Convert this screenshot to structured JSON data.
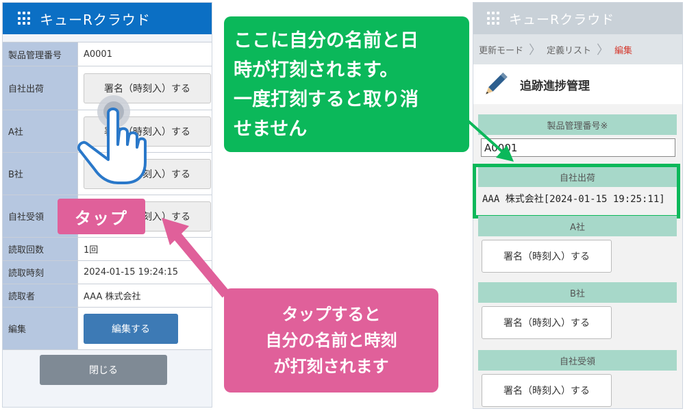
{
  "left_app": {
    "app_title": "キューRクラウド",
    "rows": [
      {
        "label": "製品管理番号",
        "value": "A0001"
      },
      {
        "label": "自社出荷",
        "button": "署名（時刻入）する"
      },
      {
        "label": "A社",
        "button": "署名（時刻入）する"
      },
      {
        "label": "B社",
        "button": "署名（時刻入）する"
      },
      {
        "label": "自社受領",
        "button": "署名（時刻入）する"
      },
      {
        "label": "読取回数",
        "value": "1回"
      },
      {
        "label": "読取時刻",
        "value": "2024-01-15 19:24:15"
      },
      {
        "label": "読取者",
        "value": "AAA 株式会社"
      },
      {
        "label": "編集",
        "button": "編集する"
      }
    ],
    "close_label": "閉じる"
  },
  "annotations": {
    "tap_label": "タップ",
    "pink_callout": [
      "タップすると",
      "自分の名前と時刻",
      "が打刻されます"
    ],
    "green_callout": [
      "ここに自分の名前と日",
      "時が打刻されます。",
      "一度打刻すると取り消",
      "せません"
    ]
  },
  "right_app": {
    "app_title": "キューRクラウド",
    "breadcrumb": [
      "更新モード",
      "定義リスト",
      "編集"
    ],
    "page_title": "追跡進捗管理",
    "product_no_label": "製品管理番号※",
    "product_no_value": "A0001",
    "sections": [
      {
        "label": "自社出荷",
        "stamp": "AAA 株式会社[2024-01-15 19:25:11]"
      },
      {
        "label": "A社",
        "button": "署名（時刻入）する"
      },
      {
        "label": "B社",
        "button": "署名（時刻入）する"
      },
      {
        "label": "自社受領",
        "button": "署名（時刻入）する"
      }
    ]
  },
  "colors": {
    "header_blue": "#0b6fc4",
    "label_blue": "#b6c7e0",
    "pink": "#e0609a",
    "green": "#0bb85a",
    "mint": "#a7d8c9",
    "edit_blue": "#3d7ab5",
    "close_gray": "#7f8a95"
  },
  "icons": {
    "app_menu": "grid-icon",
    "title_icon": "pencil-icon",
    "gesture": "tap-hand-icon",
    "breadcrumb_sep": "chevron-right-icon"
  }
}
